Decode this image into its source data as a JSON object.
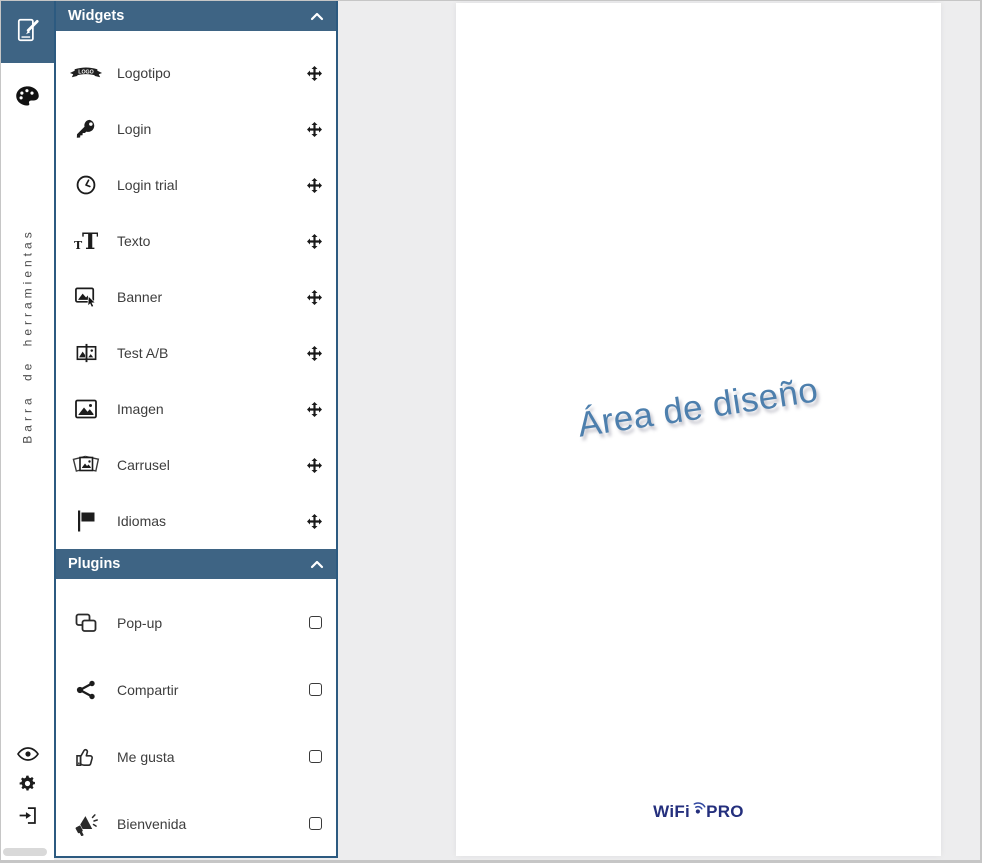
{
  "toolbar": {
    "vertical_label": "Barra de herramientas",
    "icons": {
      "top": "tablet-edit-icon",
      "palette": "palette-icon",
      "preview": "eye-icon",
      "settings": "gear-icon",
      "logout": "sign-out-icon"
    }
  },
  "widgets_panel": {
    "title": "Widgets",
    "collapse_icon": "chevron-up-icon",
    "drag_handle_icon": "move-arrows-icon",
    "items": [
      {
        "label": "Logotipo",
        "icon": "logo-ribbon-icon",
        "icon_text": "LOGO"
      },
      {
        "label": "Login",
        "icon": "key-icon"
      },
      {
        "label": "Login trial",
        "icon": "clock-icon"
      },
      {
        "label": "Texto",
        "icon": "text-icon",
        "icon_text": "T"
      },
      {
        "label": "Banner",
        "icon": "banner-cursor-icon"
      },
      {
        "label": "Test A/B",
        "icon": "split-image-icon"
      },
      {
        "label": "Imagen",
        "icon": "image-icon"
      },
      {
        "label": "Carrusel",
        "icon": "photo-stack-icon"
      },
      {
        "label": "Idiomas",
        "icon": "flag-icon"
      }
    ]
  },
  "plugins_panel": {
    "title": "Plugins",
    "collapse_icon": "chevron-up-icon",
    "items": [
      {
        "label": "Pop-up",
        "icon": "popup-windows-icon"
      },
      {
        "label": "Compartir",
        "icon": "share-nodes-icon"
      },
      {
        "label": "Me gusta",
        "icon": "thumbs-up-icon"
      },
      {
        "label": "Bienvenida",
        "icon": "megaphone-icon"
      }
    ]
  },
  "design_area": {
    "watermark": "Área de diseño",
    "logo": {
      "prefix": "WiFi",
      "suffix": "PRO",
      "mark": "wifi-dot-icon"
    }
  },
  "colors": {
    "header_blue": "#3e6484",
    "panel_border": "#2c5a80",
    "workspace_bg": "#ededee",
    "canvas_bg": "#ffffff",
    "watermark_blue": "#4d7fad",
    "logo_navy": "#242f7d",
    "icon_dark": "#1c1c1c"
  }
}
